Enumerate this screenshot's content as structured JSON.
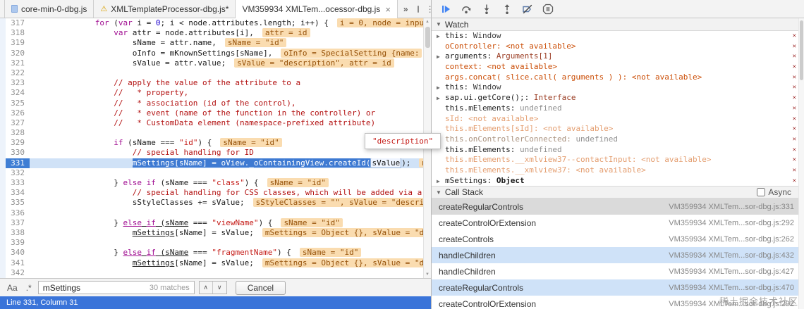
{
  "tabs": {
    "overflow": "»",
    "items": [
      {
        "label": "core-min-0-dbg.js",
        "icon": "file-icon",
        "active": false,
        "closable": false
      },
      {
        "label": "XMLTemplateProcessor-dbg.js*",
        "icon": "warning-icon",
        "active": false,
        "closable": false
      },
      {
        "label": "VM359934 XMLTem...ocessor-dbg.js",
        "icon": null,
        "active": true,
        "closable": true
      }
    ]
  },
  "toolbar": {
    "buttons": [
      "resume",
      "step-over",
      "step-into",
      "step-out",
      "deactivate-breakpoints",
      "pause-on-exceptions"
    ]
  },
  "editor": {
    "status": "Line 331, Column 31",
    "tooltip": "\"description\"",
    "lines": [
      {
        "n": 317,
        "ind": 14,
        "toks": [
          [
            "for",
            "k"
          ],
          [
            " (",
            "p"
          ],
          [
            "var",
            "k"
          ],
          [
            " i = ",
            "p"
          ],
          [
            "0",
            "n"
          ],
          [
            "; i < node.attributes.length; i++) {",
            "p"
          ]
        ],
        "ann": "i = 0, node = inpu"
      },
      {
        "n": 318,
        "ind": 18,
        "toks": [
          [
            "var",
            "k"
          ],
          [
            " attr = node.attributes[i],",
            "p"
          ]
        ],
        "ann": "attr = id"
      },
      {
        "n": 319,
        "ind": 22,
        "toks": [
          [
            "sName = attr.name,",
            "p"
          ]
        ],
        "ann": "sName = \"id\""
      },
      {
        "n": 320,
        "ind": 22,
        "toks": [
          [
            "oInfo = mKnownSettings[sName],",
            "p"
          ]
        ],
        "ann": "oInfo = SpecialSetting {name:"
      },
      {
        "n": 321,
        "ind": 22,
        "toks": [
          [
            "sValue = attr.value;",
            "p"
          ]
        ],
        "ann": "sValue = \"description\", attr = id"
      },
      {
        "n": 322,
        "ind": 0,
        "toks": []
      },
      {
        "n": 323,
        "ind": 18,
        "toks": [
          [
            "// apply the value of the attribute to a",
            "c"
          ]
        ]
      },
      {
        "n": 324,
        "ind": 18,
        "toks": [
          [
            "//   * property,",
            "c"
          ]
        ]
      },
      {
        "n": 325,
        "ind": 18,
        "toks": [
          [
            "//   * association (id of the control),",
            "c"
          ]
        ]
      },
      {
        "n": 326,
        "ind": 18,
        "toks": [
          [
            "//   * event (name of the function in the controller) or",
            "c"
          ]
        ]
      },
      {
        "n": 327,
        "ind": 18,
        "toks": [
          [
            "//   * CustomData element (namespace-prefixed attribute)",
            "c"
          ]
        ]
      },
      {
        "n": 328,
        "ind": 0,
        "toks": []
      },
      {
        "n": 329,
        "ind": 18,
        "toks": [
          [
            "if",
            "k"
          ],
          [
            " (sName === ",
            "p"
          ],
          [
            "\"id\"",
            "s"
          ],
          [
            ") {",
            "p"
          ]
        ],
        "ann": "sName = \"id\""
      },
      {
        "n": 330,
        "ind": 22,
        "toks": [
          [
            "// special handling for ID",
            "c"
          ]
        ]
      },
      {
        "n": 331,
        "ind": 22,
        "exec": true,
        "toks": [
          [
            "mSettings[sName] = oView._oContainingView.createId(",
            "sel"
          ],
          [
            "sValue",
            "box"
          ],
          [
            ");",
            "p"
          ]
        ],
        "ann": "m"
      },
      {
        "n": 332,
        "ind": 0,
        "toks": []
      },
      {
        "n": 333,
        "ind": 18,
        "toks": [
          [
            "} ",
            "p"
          ],
          [
            "else",
            "k"
          ],
          [
            " ",
            "p"
          ],
          [
            "if",
            "k"
          ],
          [
            " (sName === ",
            "p"
          ],
          [
            "\"class\"",
            "s"
          ],
          [
            ") {",
            "p"
          ]
        ],
        "ann": "sName = \"id\""
      },
      {
        "n": 334,
        "ind": 22,
        "toks": [
          [
            "// special handling for CSS classes, which will be added via a",
            "c"
          ]
        ]
      },
      {
        "n": 335,
        "ind": 22,
        "toks": [
          [
            "sStyleClasses += sValue;",
            "p"
          ]
        ],
        "ann": "sStyleClasses = \"\", sValue = \"descri"
      },
      {
        "n": 336,
        "ind": 0,
        "toks": []
      },
      {
        "n": 337,
        "ind": 18,
        "toks": [
          [
            "} ",
            "p"
          ],
          [
            "else",
            "ku"
          ],
          [
            " ",
            "pu"
          ],
          [
            "if",
            "ku"
          ],
          [
            " (sName",
            "pu"
          ],
          [
            " === ",
            "p"
          ],
          [
            "\"viewName\"",
            "s"
          ],
          [
            ") {",
            "p"
          ]
        ],
        "ann": "sName = \"id\""
      },
      {
        "n": 338,
        "ind": 22,
        "toks": [
          [
            "mSettings",
            "pu"
          ],
          [
            "[sName] = sValue;",
            "p"
          ]
        ],
        "ann": "mSettings = Object {}, sValue = \"d"
      },
      {
        "n": 339,
        "ind": 0,
        "toks": []
      },
      {
        "n": 340,
        "ind": 18,
        "toks": [
          [
            "} ",
            "p"
          ],
          [
            "else",
            "ku"
          ],
          [
            " ",
            "pu"
          ],
          [
            "if",
            "ku"
          ],
          [
            " (sName",
            "pu"
          ],
          [
            " === ",
            "p"
          ],
          [
            "\"fragmentName\"",
            "s"
          ],
          [
            ") {",
            "p"
          ]
        ],
        "ann": "sName = \"id\""
      },
      {
        "n": 341,
        "ind": 22,
        "toks": [
          [
            "mSettings",
            "pu"
          ],
          [
            "[sName] = sValue;",
            "p"
          ]
        ],
        "ann": "mSettings = Object {}, sValue = \"d"
      },
      {
        "n": 342,
        "ind": 0,
        "toks": []
      }
    ]
  },
  "search": {
    "case_label": "Aa",
    "regex_label": ".*",
    "query": "mSettings",
    "matches": "30 matches",
    "prev_label": "∧",
    "next_label": "∨",
    "cancel_label": "Cancel"
  },
  "sidebar": {
    "watch": {
      "title": "Watch",
      "items": [
        {
          "exp": true,
          "name": "this",
          "value": "Window",
          "cls": "norm",
          "vcls": "vwin"
        },
        {
          "name": "oController",
          "value": "<not available>",
          "cls": "err"
        },
        {
          "exp": true,
          "name": "arguments",
          "value": "Arguments[1]",
          "cls": "norm",
          "vcls": "vobj"
        },
        {
          "name": "context",
          "value": "<not available>",
          "cls": "err"
        },
        {
          "name": "args.concat( slice.call( arguments ) )",
          "value": "<not available>",
          "cls": "err"
        },
        {
          "exp": true,
          "name": "this",
          "value": "Window",
          "cls": "norm",
          "vcls": "vwin"
        },
        {
          "exp": true,
          "name": "sap.ui.getCore();",
          "value": "Interface",
          "cls": "norm",
          "vcls": "vobj"
        },
        {
          "name": "this.mElements",
          "value": "undefined",
          "cls": "norm",
          "vcls": "vundef"
        },
        {
          "name": "sId",
          "value": "<not available>",
          "cls": "errf"
        },
        {
          "name": "this.mElements[sId]",
          "value": "<not available>",
          "cls": "errf"
        },
        {
          "name": "this.onControllerConnected",
          "value": "undefined",
          "cls": "fade",
          "vcls": "vundef"
        },
        {
          "name": "this.mElements",
          "value": "undefined",
          "cls": "norm",
          "vcls": "vundef"
        },
        {
          "name": "this.mElements.__xmlview37--contactInput",
          "value": "<not available>",
          "cls": "errf"
        },
        {
          "name": "this.mElements.__xmlview37",
          "value": "<not available>",
          "cls": "errf"
        },
        {
          "exp": true,
          "name": "mSettings",
          "value": "Object",
          "cls": "norm",
          "vcls": "vobjb"
        }
      ]
    },
    "call_stack": {
      "title": "Call Stack",
      "async_label": "Async",
      "frames": [
        {
          "fn": "createRegularControls",
          "loc": "VM359934 XMLTem...sor-dbg.js:331",
          "hl": "sel"
        },
        {
          "fn": "createControlOrExtension",
          "loc": "VM359934 XMLTem...sor-dbg.js:292"
        },
        {
          "fn": "createControls",
          "loc": "VM359934 XMLTem...sor-dbg.js:262"
        },
        {
          "fn": "handleChildren",
          "loc": "VM359934 XMLTem...sor-dbg.js:432",
          "hl": "alt"
        },
        {
          "fn": "handleChildren",
          "loc": "VM359934 XMLTem...sor-dbg.js:427"
        },
        {
          "fn": "createRegularControls",
          "loc": "VM359934 XMLTem...sor-dbg.js:470",
          "hl": "alt"
        },
        {
          "fn": "createControlOrExtension",
          "loc": "VM359934 XMLTem...sor-dbg.js:292"
        }
      ]
    }
  },
  "icons": {
    "section_collapse": "▼",
    "expander": "▶",
    "close_tab": "×",
    "delete_watch": "✕",
    "warning": "⚠",
    "more": "⋮",
    "scroll_up": "▲",
    "scroll_down": "▼"
  },
  "watermark": "稀土掘金技术社区",
  "colors": {
    "kw": "#a00d91",
    "str": "#c41a16",
    "com": "#b31212",
    "num": "#1c00cf",
    "plain": "#1a1a1a",
    "annbg": "#fadcb0",
    "annfg": "#96520a",
    "execbg": "#d0e2f7",
    "selbg": "#3e7ad2",
    "gutterblue": "#3f7ed4",
    "err": "#cb4e07",
    "errf": "#e49e70",
    "statusbg": "#3a74d9",
    "cs-sel": "#dadada",
    "cs-alt": "#cfe2f8",
    "accent": "#4285f4"
  }
}
